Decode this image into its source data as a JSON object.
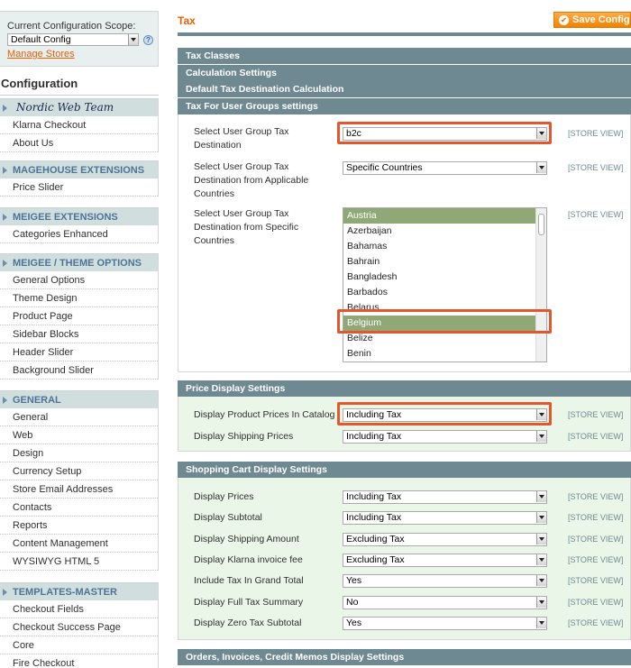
{
  "scope": {
    "label": "Current Configuration Scope:",
    "value": "Default Config",
    "manage_link": "Manage Stores"
  },
  "sidebar": {
    "title": "Configuration",
    "groups": [
      {
        "title": "Nordic Web Team",
        "items": [
          "Klarna Checkout",
          "About Us"
        ]
      },
      {
        "title": "MAGEHOUSE EXTENSIONS",
        "items": [
          "Price Slider"
        ]
      },
      {
        "title": "MEIGEE EXTENSIONS",
        "items": [
          "Categories Enhanced"
        ]
      },
      {
        "title": "MEIGEE / THEME OPTIONS",
        "items": [
          "General Options",
          "Theme Design",
          "Product Page",
          "Sidebar Blocks",
          "Header Slider",
          "Background Slider"
        ]
      },
      {
        "title": "GENERAL",
        "items": [
          "General",
          "Web",
          "Design",
          "Currency Setup",
          "Store Email Addresses",
          "Contacts",
          "Reports",
          "Content Management",
          "WYSIWYG HTML 5"
        ]
      },
      {
        "title": "TEMPLATES-MASTER",
        "items": [
          "Checkout Fields",
          "Checkout Success Page",
          "Core",
          "Fire Checkout"
        ]
      }
    ]
  },
  "page": {
    "title": "Tax",
    "save_label": "Save Config"
  },
  "sections": {
    "tax_classes": "Tax Classes",
    "calc": "Calculation Settings",
    "default_dest": "Default Tax Destination Calculation",
    "user_groups": "Tax For User Groups settings",
    "price_display": "Price Display Settings",
    "cart_display": "Shopping Cart Display Settings",
    "orders_display": "Orders, Invoices, Credit Memos Display Settings"
  },
  "scope_tag": "[STORE VIEW]",
  "user_group_fields": [
    {
      "label": "Select User Group Tax Destination",
      "value": "b2c"
    },
    {
      "label": "Select User Group Tax Destination from Applicable Countries",
      "value": "Specific Countries"
    },
    {
      "label": "Select User Group Tax Destination from Specific Countries"
    }
  ],
  "countries": [
    {
      "name": "Austria",
      "selected": true
    },
    {
      "name": "Azerbaijan",
      "selected": false
    },
    {
      "name": "Bahamas",
      "selected": false
    },
    {
      "name": "Bahrain",
      "selected": false
    },
    {
      "name": "Bangladesh",
      "selected": false
    },
    {
      "name": "Barbados",
      "selected": false
    },
    {
      "name": "Belarus",
      "selected": false
    },
    {
      "name": "Belgium",
      "selected": true
    },
    {
      "name": "Belize",
      "selected": false
    },
    {
      "name": "Benin",
      "selected": false
    }
  ],
  "price_fields": [
    {
      "label": "Display Product Prices In Catalog",
      "value": "Including Tax"
    },
    {
      "label": "Display Shipping Prices",
      "value": "Including Tax"
    }
  ],
  "cart_fields": [
    {
      "label": "Display Prices",
      "value": "Including Tax"
    },
    {
      "label": "Display Subtotal",
      "value": "Including Tax"
    },
    {
      "label": "Display Shipping Amount",
      "value": "Excluding Tax"
    },
    {
      "label": "Display Klarna invoice fee",
      "value": "Excluding Tax"
    },
    {
      "label": "Include Tax In Grand Total",
      "value": "Yes"
    },
    {
      "label": "Display Full Tax Summary",
      "value": "No"
    },
    {
      "label": "Display Zero Tax Subtotal",
      "value": "Yes"
    }
  ],
  "colors": {
    "accent": "#eb5e00",
    "section_header": "#6f8992",
    "highlight": "#e4572e",
    "selected_option": "#8fa876"
  }
}
